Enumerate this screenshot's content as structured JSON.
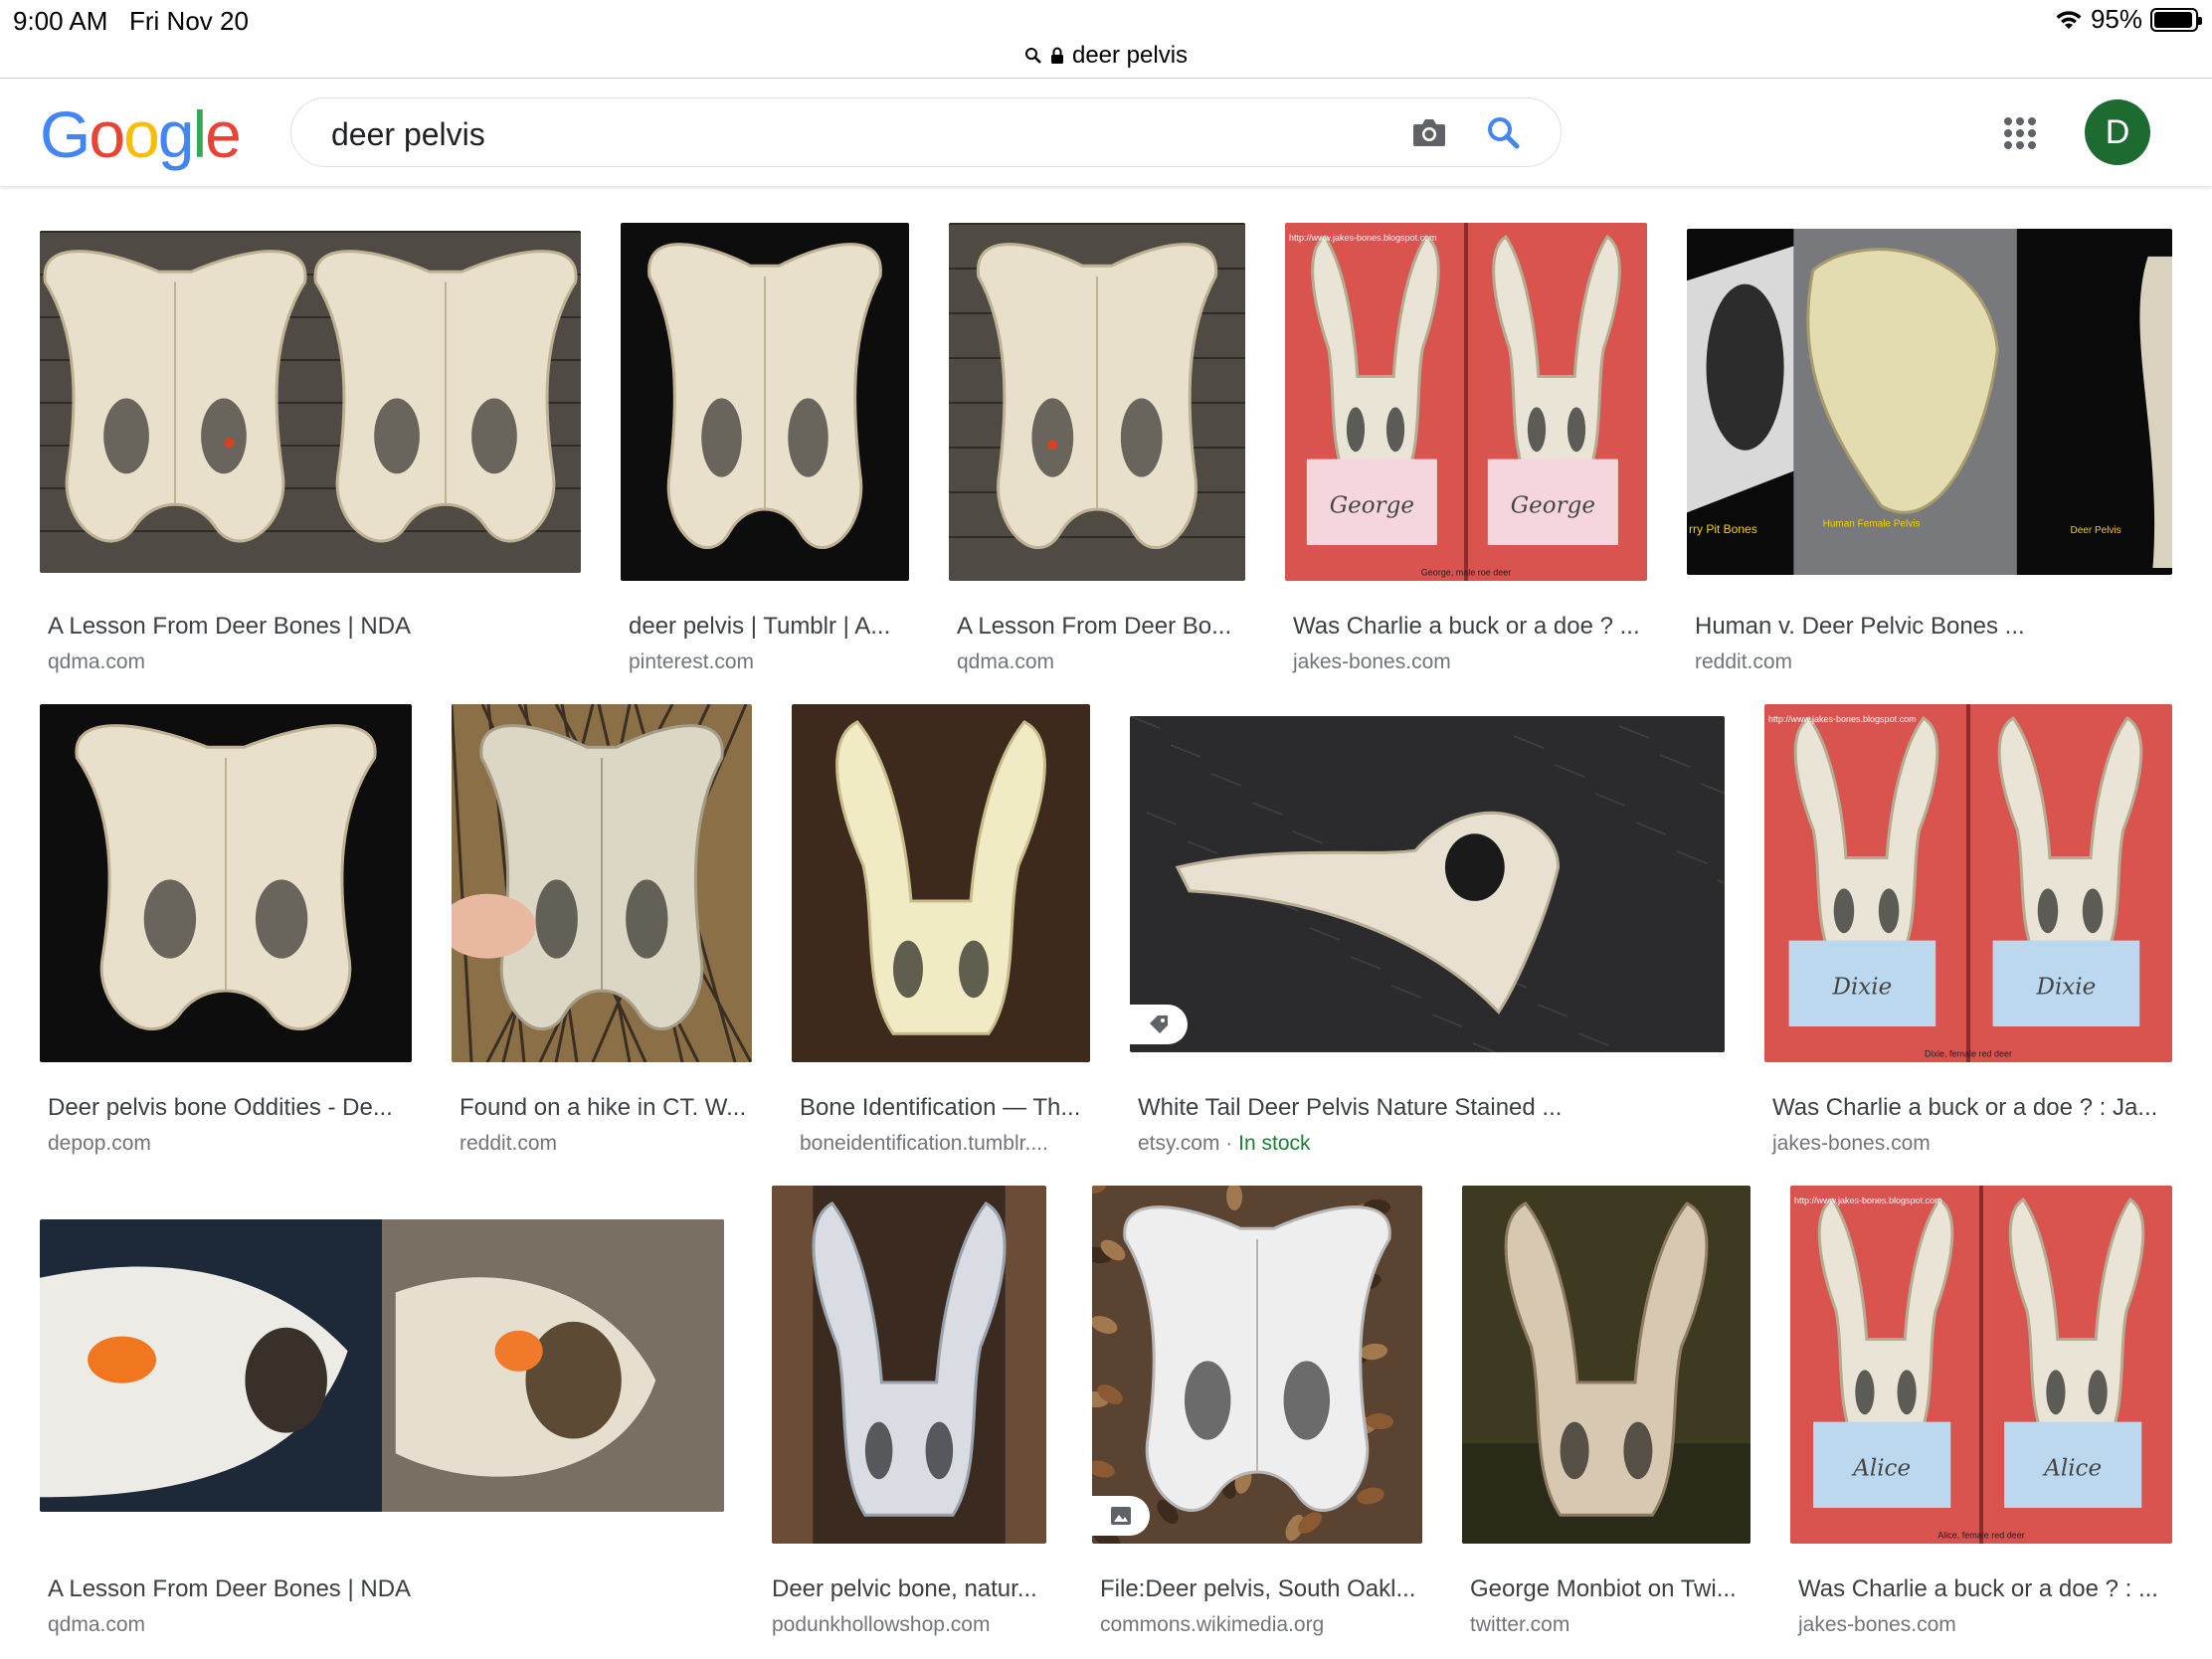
{
  "status_bar": {
    "time": "9:00 AM",
    "date": "Fri Nov 20",
    "battery": "95%",
    "battery_level": 0.95
  },
  "browser": {
    "url": "deer pelvis"
  },
  "header": {
    "logo": [
      "G",
      "o",
      "o",
      "g",
      "l",
      "e"
    ],
    "logo_colors": [
      "#4285F4",
      "#EA4335",
      "#FBBC05",
      "#4285F4",
      "#34A853",
      "#EA4335"
    ],
    "query": "deer pelvis",
    "avatar_letter": "D",
    "avatar_color": "#1e6b32"
  },
  "results": [
    {
      "title": "A Lesson From Deer Bones | NDA",
      "source": "qdma.com",
      "scene": "bones-wood"
    },
    {
      "title": "deer pelvis | Tumblr | A...",
      "source": "pinterest.com",
      "scene": "bone-dark"
    },
    {
      "title": "A Lesson From Deer Bo...",
      "source": "qdma.com",
      "scene": "bones-wood"
    },
    {
      "title": "Was Charlie a buck or a doe ? ...",
      "source": "jakes-bones.com",
      "scene": "red-cards",
      "overlay": "http://www.jakes-bones.blogspot.com",
      "card_labels": [
        "George",
        "George"
      ],
      "caption": "George, male roe deer"
    },
    {
      "title": "Human v. Deer Pelvic Bones ...",
      "source": "reddit.com",
      "scene": "human-deer",
      "labels": [
        "rry Pit Bones",
        "Human Female Pelvis",
        "Deer Pelvis"
      ]
    },
    {
      "title": "Deer pelvis bone Oddities - De...",
      "source": "depop.com",
      "scene": "bone-dark"
    },
    {
      "title": "Found on a hike in CT. W...",
      "source": "reddit.com",
      "scene": "hand-grass"
    },
    {
      "title": "Bone Identification — Th...",
      "source": "boneidentification.tumblr....",
      "scene": "bone-brown"
    },
    {
      "title": "White Tail Deer Pelvis Nature Stained ...",
      "source": "etsy.com",
      "availability": "In stock",
      "scene": "fur-dark",
      "badge": "tag-icon"
    },
    {
      "title": "Was Charlie a buck or a doe ? : Ja...",
      "source": "jakes-bones.com",
      "scene": "red-cards",
      "overlay": "http://www.jakes-bones.blogspot.com",
      "card_labels": [
        "Dixie",
        "Dixie"
      ],
      "caption": "Dixie, female red deer"
    },
    {
      "title": "A Lesson From Deer Bones | NDA",
      "source": "qdma.com",
      "scene": "closeup-orange"
    },
    {
      "title": "Deer pelvic bone, natur...",
      "source": "podunkhollowshop.com",
      "scene": "bone-fur"
    },
    {
      "title": "File:Deer pelvis, South Oakl...",
      "source": "commons.wikimedia.org",
      "scene": "leaves",
      "badge": "image-icon"
    },
    {
      "title": "George Monbiot on Twi...",
      "source": "twitter.com",
      "scene": "bone-olive"
    },
    {
      "title": "Was Charlie a buck or a doe ? : ...",
      "source": "jakes-bones.com",
      "scene": "red-cards",
      "overlay": "http://www.jakes-bones.blogspot.com",
      "card_labels": [
        "Alice",
        "Alice"
      ],
      "caption": "Alice, female red deer"
    }
  ]
}
